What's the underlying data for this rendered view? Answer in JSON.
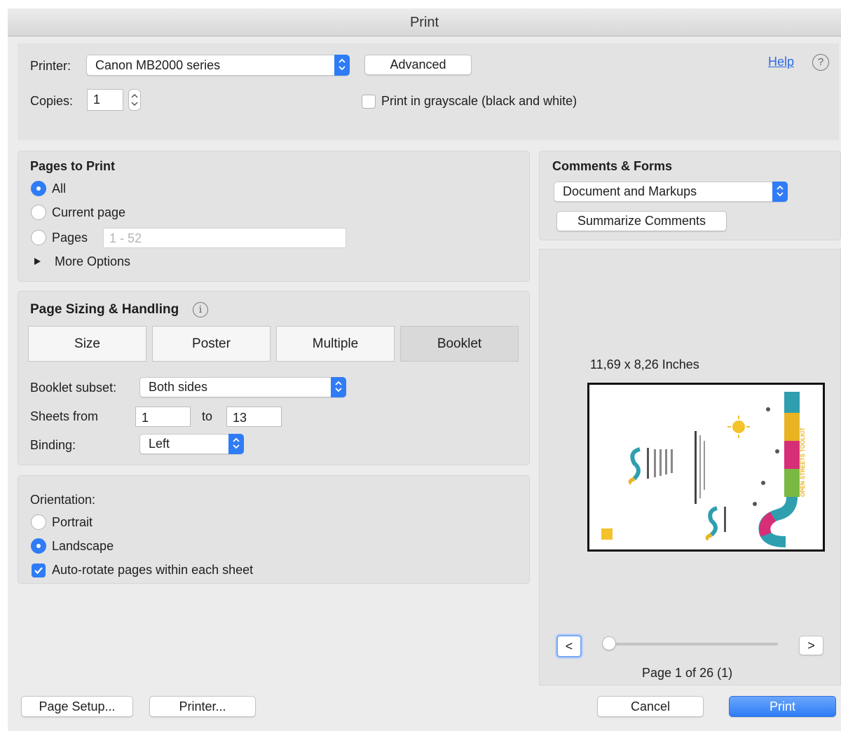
{
  "window": {
    "title": "Print"
  },
  "printer": {
    "label": "Printer:",
    "value": "Canon MB2000 series",
    "advanced_button": "Advanced",
    "help_link": "Help",
    "copies_label": "Copies:",
    "copies_value": "1",
    "grayscale_label": "Print in grayscale (black and white)",
    "grayscale_checked": false
  },
  "pages_to_print": {
    "title": "Pages to Print",
    "options": [
      "All",
      "Current page",
      "Pages"
    ],
    "selected": "All",
    "pages_placeholder": "1 - 52",
    "more_options": "More Options"
  },
  "page_sizing": {
    "title": "Page Sizing & Handling",
    "tabs": [
      "Size",
      "Poster",
      "Multiple",
      "Booklet"
    ],
    "active_tab": "Booklet",
    "booklet_subset_label": "Booklet subset:",
    "booklet_subset_value": "Both sides",
    "sheets_from_label": "Sheets from",
    "sheets_from_value": "1",
    "sheets_to_label": "to",
    "sheets_to_value": "13",
    "binding_label": "Binding:",
    "binding_value": "Left"
  },
  "orientation": {
    "title": "Orientation:",
    "options": [
      "Portrait",
      "Landscape"
    ],
    "selected": "Landscape",
    "auto_rotate_label": "Auto-rotate pages within each sheet",
    "auto_rotate_checked": true
  },
  "comments_forms": {
    "title": "Comments & Forms",
    "value": "Document and Markups",
    "summarize_button": "Summarize Comments"
  },
  "preview": {
    "paper_size": "11,69 x 8,26 Inches",
    "page_text": "Page 1 of 26 (1)",
    "slider_fraction": 0,
    "prev_button": "<",
    "next_button": ">",
    "cover_text": "OPEN STREETS TOOLKIT"
  },
  "footer": {
    "page_setup_button": "Page Setup...",
    "printer_button": "Printer...",
    "cancel_button": "Cancel",
    "print_button": "Print"
  },
  "colors": {
    "accent": "#2f7cf6",
    "link": "#2d6be0"
  }
}
